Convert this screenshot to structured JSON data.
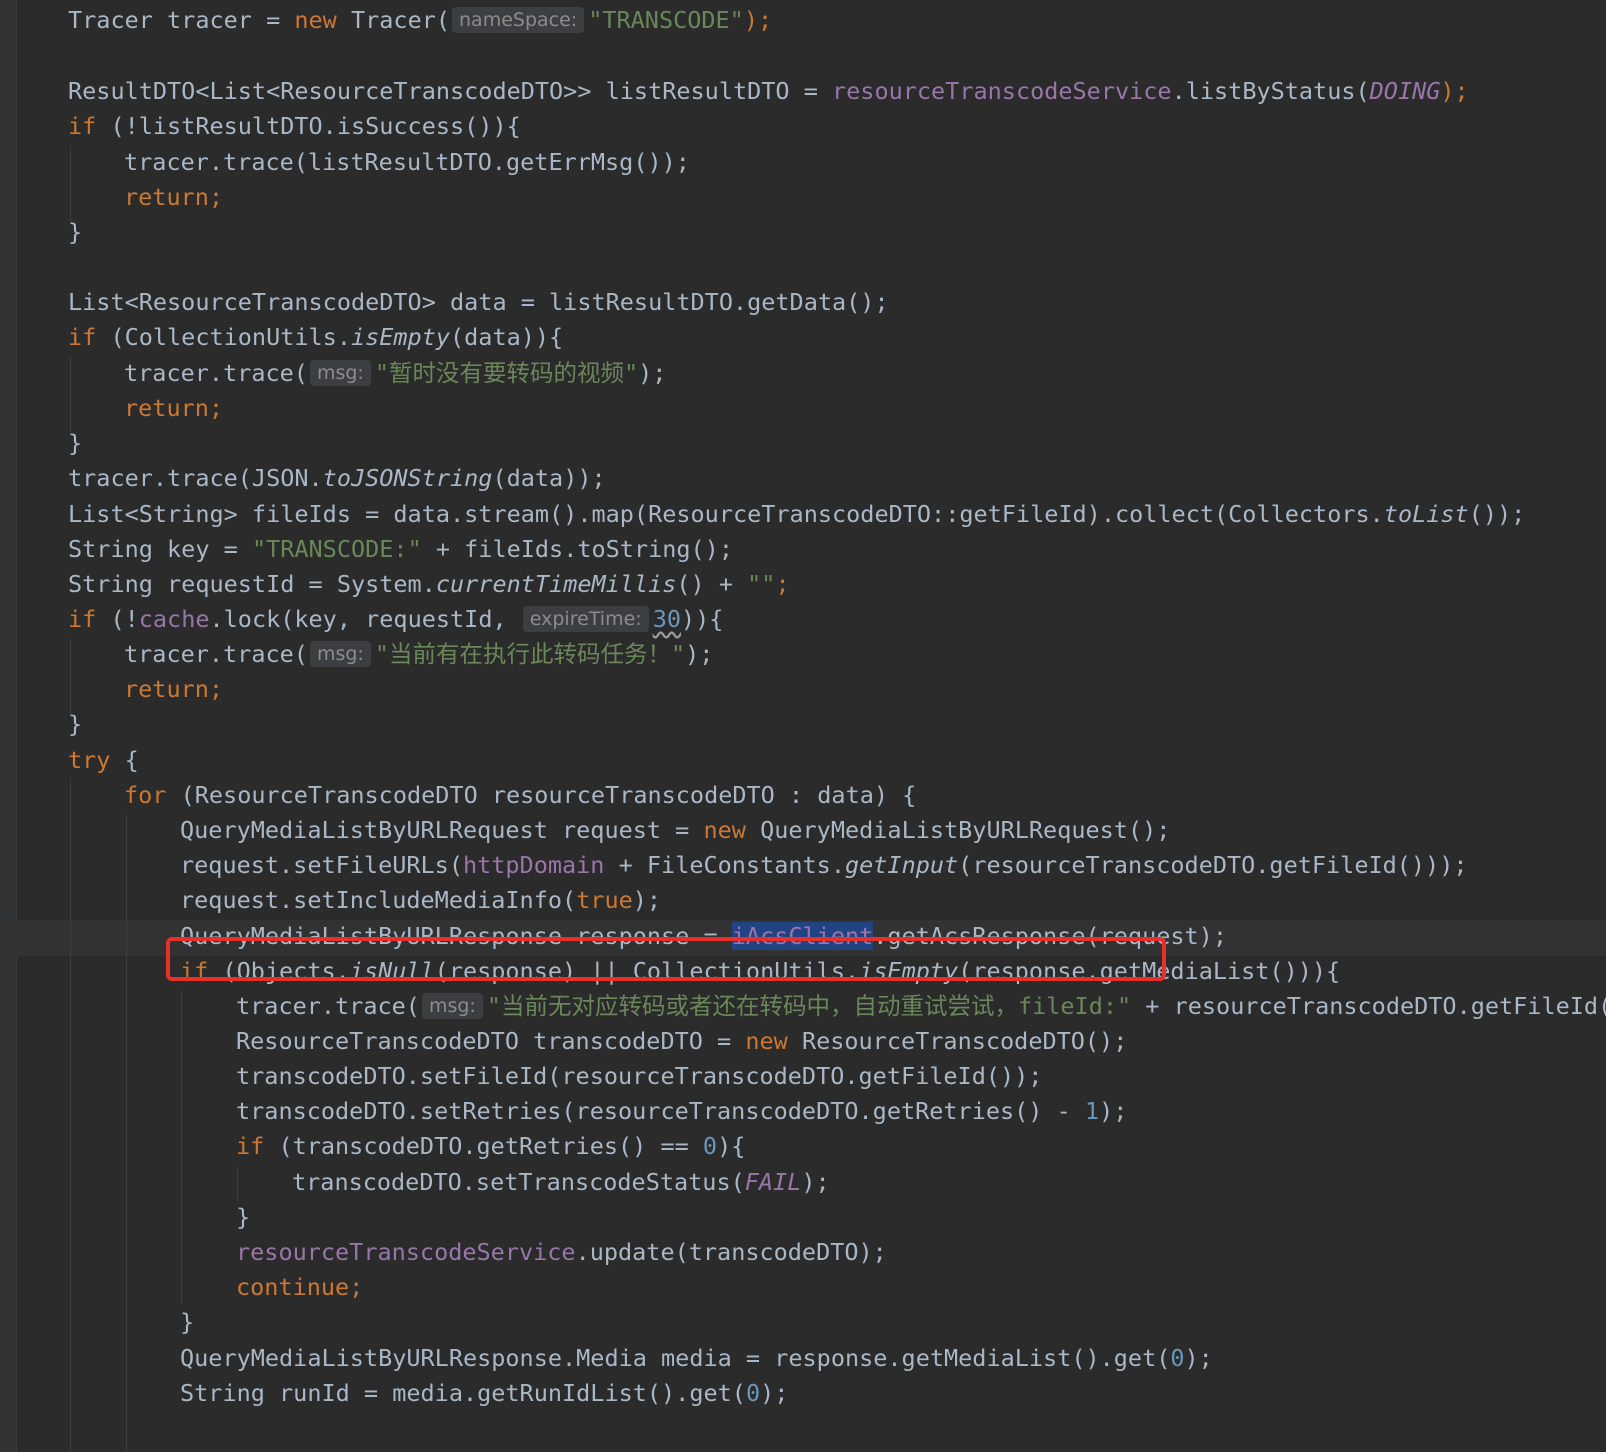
{
  "editor": {
    "hints": {
      "nameSpace": "nameSpace:",
      "msg": "msg:",
      "expireTime": "expireTime:"
    },
    "lines": [
      {
        "a": "Tracer tracer = ",
        "b": "new",
        "c": " Tracer(",
        "d": "\"TRANSCODE\"",
        "e": ");"
      },
      {
        "a": "ResultDTO<List<ResourceTranscodeDTO>> listResultDTO = ",
        "b": "resourceTranscodeService",
        "c": ".listByStatus(",
        "d": "DOING",
        "e": ");"
      },
      {
        "a": "if",
        "b": " (!listResultDTO.isSuccess()){"
      },
      {
        "a": "tracer.trace(listResultDTO.getErrMsg());"
      },
      {
        "a": "return;"
      },
      {
        "a": "}"
      },
      {
        "a": "List<ResourceTranscodeDTO> data = listResultDTO.getData();"
      },
      {
        "a": "if",
        "b": " (CollectionUtils.",
        "c": "isEmpty",
        "d": "(data)){"
      },
      {
        "a": "tracer.trace(",
        "b": "\"暂时没有要转码的视频\"",
        "c": ");"
      },
      {
        "a": "return;"
      },
      {
        "a": "}"
      },
      {
        "a": "tracer.trace(JSON.",
        "b": "toJSONString",
        "c": "(data));"
      },
      {
        "a": "List<String> fileIds = data.stream().map(ResourceTranscodeDTO::getFileId).collect(Collectors.",
        "b": "toList",
        "c": "());"
      },
      {
        "a": "String key = ",
        "b": "\"TRANSCODE:\"",
        "c": " + fileIds.toString();"
      },
      {
        "a": "String requestId = System.",
        "b": "currentTimeMillis",
        "c": "() + ",
        "d": "\"\"",
        "e": ";"
      },
      {
        "a": "if",
        "b": " (!",
        "c": "cache",
        "d": ".lock(key, requestId, ",
        "e": "30",
        "f": ")){"
      },
      {
        "a": "tracer.trace(",
        "b": "\"当前有在执行此转码任务！\"",
        "c": ");"
      },
      {
        "a": "return;"
      },
      {
        "a": "}"
      },
      {
        "a": "try",
        "b": " {"
      },
      {
        "a": "for",
        "b": " (ResourceTranscodeDTO resourceTranscodeDTO : data) {"
      },
      {
        "a": "QueryMediaListByURLRequest request = ",
        "b": "new",
        "c": " QueryMediaListByURLRequest();"
      },
      {
        "a": "request.setFileURLs(",
        "b": "httpDomain",
        "c": " + FileConstants.",
        "d": "getInput",
        "e": "(resourceTranscodeDTO.getFileId()));"
      },
      {
        "a": "request.setIncludeMediaInfo(",
        "b": "true",
        "c": ");"
      },
      {
        "a": "QueryMediaListByURLResponse response = ",
        "b": "iAcsClient",
        "c": ".getAcsResponse(request);"
      },
      {
        "a": "if",
        "b": " (Objects.",
        "c": "isNull",
        "d": "(response) || CollectionUtils.",
        "e": "isEmpty",
        "f": "(response.getMediaList())){"
      },
      {
        "a": "tracer.trace(",
        "b": "\"当前无对应转码或者还在转码中，自动重试尝试，fileId:\"",
        "c": " + resourceTranscodeDTO.getFileId());"
      },
      {
        "a": "ResourceTranscodeDTO transcodeDTO = ",
        "b": "new",
        "c": " ResourceTranscodeDTO();"
      },
      {
        "a": "transcodeDTO.setFileId(resourceTranscodeDTO.getFileId());"
      },
      {
        "a": "transcodeDTO.setRetries(resourceTranscodeDTO.getRetries() - ",
        "b": "1",
        "c": ");"
      },
      {
        "a": "if",
        "b": " (transcodeDTO.getRetries() == ",
        "c": "0",
        "d": "){"
      },
      {
        "a": "transcodeDTO.setTranscodeStatus(",
        "b": "FAIL",
        "c": ");"
      },
      {
        "a": "}"
      },
      {
        "a": "resourceTranscodeService",
        "b": ".update(transcodeDTO);"
      },
      {
        "a": "continue;"
      },
      {
        "a": "}"
      },
      {
        "a": "QueryMediaListByURLResponse.Media media = response.getMediaList().get(",
        "b": "0",
        "c": ");"
      },
      {
        "a": "String runId = media.getRunIdList().get(",
        "b": "0",
        "c": ");"
      }
    ]
  }
}
